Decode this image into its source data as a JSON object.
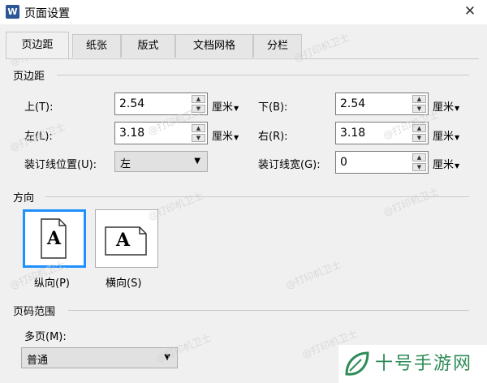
{
  "window": {
    "title": "页面设置",
    "app_icon": "W"
  },
  "tabs": [
    {
      "label": "页边距"
    },
    {
      "label": "纸张"
    },
    {
      "label": "版式"
    },
    {
      "label": "文档网格"
    },
    {
      "label": "分栏"
    }
  ],
  "margins": {
    "section_title": "页边距",
    "top": {
      "label": "上(T):",
      "value": "2.54",
      "unit": "厘米"
    },
    "bottom": {
      "label": "下(B):",
      "value": "2.54",
      "unit": "厘米"
    },
    "left": {
      "label": "左(L):",
      "value": "3.18",
      "unit": "厘米"
    },
    "right": {
      "label": "右(R):",
      "value": "3.18",
      "unit": "厘米"
    },
    "gutter_position": {
      "label": "装订线位置(U):",
      "value": "左"
    },
    "gutter_width": {
      "label": "装订线宽(G):",
      "value": "0",
      "unit": "厘米"
    }
  },
  "orientation": {
    "section_title": "方向",
    "portrait": {
      "label": "纵向(P)",
      "glyph": "A",
      "selected": true
    },
    "landscape": {
      "label": "横向(S)",
      "glyph": "A",
      "selected": false
    }
  },
  "pages": {
    "section_title": "页码范围",
    "multiple_label": "多页(M):",
    "multiple_value": "普通"
  },
  "watermark": "打印机卫士",
  "brand": {
    "text": "十号手游网",
    "color": "#2e8b57"
  },
  "colors": {
    "selection": "#1e90ff"
  }
}
